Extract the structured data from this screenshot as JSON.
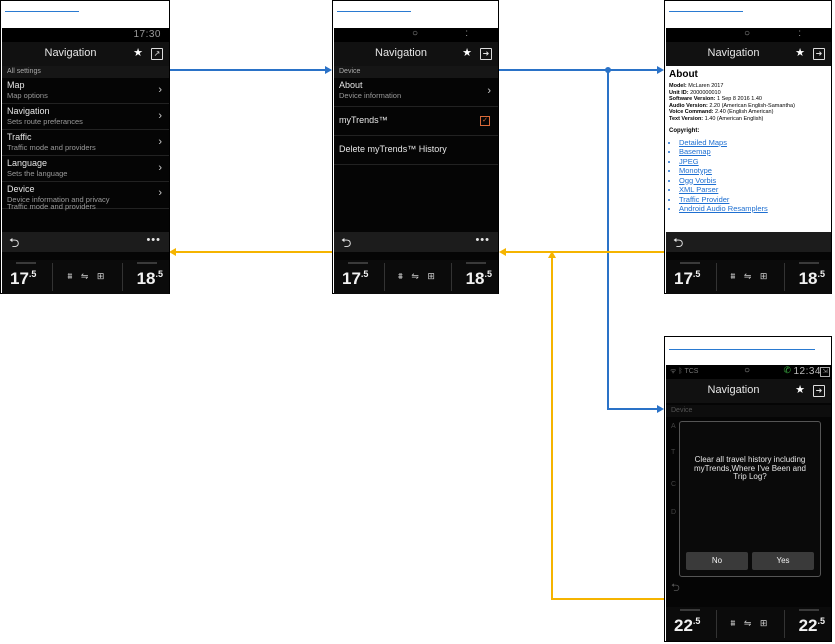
{
  "screens": {
    "settings": {
      "status_time": "17:30",
      "title": "Navigation",
      "section": "All settings",
      "items": [
        {
          "title": "Map",
          "subtitle": "Map options"
        },
        {
          "title": "Navigation",
          "subtitle": "Sets route preferances"
        },
        {
          "title": "Traffic",
          "subtitle": "Traffic mode and providers"
        },
        {
          "title": "Language",
          "subtitle": "Sets the language"
        },
        {
          "title": "Device",
          "subtitle": "Device information and privacy",
          "subtitle2": "Traffic mode and providers"
        }
      ],
      "temp_left": "17",
      "temp_left_dec": ".5",
      "temp_right": "18",
      "temp_right_dec": ".5"
    },
    "device": {
      "title": "Navigation",
      "section": "Device",
      "about_title": "About",
      "about_subtitle": "Device information",
      "mytrends_label": "myTrends™",
      "delete_label": "Delete myTrends™ History",
      "temp_left": "17",
      "temp_left_dec": ".5",
      "temp_right": "18",
      "temp_right_dec": ".5"
    },
    "about": {
      "title": "Navigation",
      "heading": "About",
      "info": [
        {
          "key": "Model:",
          "val": " McLaren 2017"
        },
        {
          "key": "Unit ID:",
          "val": " 2000000010"
        },
        {
          "key": "Software Version:",
          "val": " 1 Sep 8 2016 1.40"
        },
        {
          "key": "Audio Version:",
          "val": " 2.20 (American English-Samantha)"
        },
        {
          "key": "Voice Command:",
          "val": " 2.40 (English American)"
        },
        {
          "key": "Text Version:",
          "val": " 1.40 (American English)"
        }
      ],
      "copyright_label": "Copyright:",
      "links": [
        "Detailed Maps",
        "Basemap",
        "JPEG",
        "Monotype",
        "Ogg Vorbis",
        "XML Parser",
        "Traffic Provider",
        "Android Audio Resamplers"
      ],
      "temp_left": "17",
      "temp_left_dec": ".5",
      "temp_right": "18",
      "temp_right_dec": ".5"
    },
    "dialog": {
      "status_left": "ᯤ ᛒ TCS",
      "status_time": "12:34",
      "title": "Navigation",
      "section": "Device",
      "message": "Clear all travel history including myTrends,Where I've Been and Trip Log?",
      "no_label": "No",
      "yes_label": "Yes",
      "temp_left": "22",
      "temp_left_dec": ".5",
      "temp_right": "22",
      "temp_right_dec": ".5"
    }
  },
  "colors": {
    "forward_arrow": "#2a72c7",
    "back_arrow": "#f5b400"
  }
}
